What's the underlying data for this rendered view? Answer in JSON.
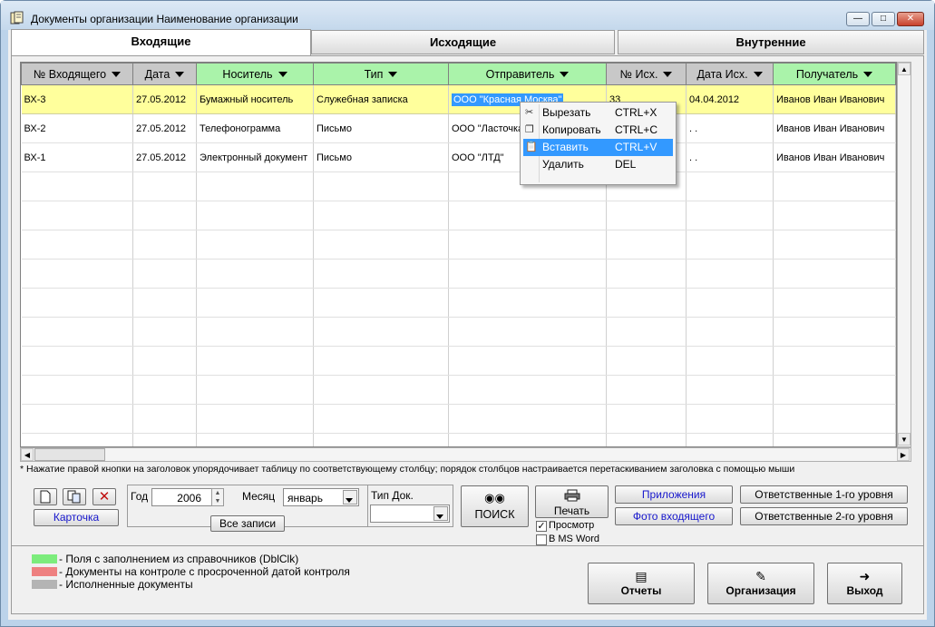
{
  "window": {
    "title": "Документы организации Наименование организации"
  },
  "tabs": [
    "Входящие",
    "Исходящие",
    "Внутренние"
  ],
  "grid": {
    "columns": [
      "№ Входящего",
      "Дата",
      "Носитель",
      "Тип",
      "Отправитель",
      "№ Исх.",
      "Дата Исх.",
      "Получатель"
    ],
    "rows": [
      [
        "ВХ-3",
        "27.05.2012",
        "Бумажный носитель",
        "Служебная записка",
        "ООО \"Красная Москва\"",
        "33",
        "04.04.2012",
        "Иванов Иван Иванович"
      ],
      [
        "ВХ-2",
        "27.05.2012",
        "Телефонограмма",
        "Письмо",
        "ООО \"Ласточка\"",
        "",
        ". .",
        "Иванов Иван Иванович"
      ],
      [
        "ВХ-1",
        "27.05.2012",
        "Электронный документ",
        "Письмо",
        "ООО \"ЛТД\"",
        "",
        ". .",
        "Иванов Иван Иванович"
      ]
    ]
  },
  "context_menu": [
    {
      "label": "Вырезать",
      "key": "CTRL+X",
      "icon": "scissors-icon"
    },
    {
      "label": "Копировать",
      "key": "CTRL+C",
      "icon": "copy-icon"
    },
    {
      "label": "Вставить",
      "key": "CTRL+V",
      "icon": "paste-icon"
    },
    {
      "label": "Удалить",
      "key": "DEL",
      "icon": ""
    }
  ],
  "hint": "* Нажатие правой кнопки на заголовок упорядочивает таблицу по соответствующему  столбцу;  порядок столбцов настраивается перетаскиванием заголовка с помощью мыши",
  "controls": {
    "card_button": "Карточка",
    "year_label": "Год",
    "year_value": "2006",
    "month_label": "Месяц",
    "month_value": "январь",
    "all_records": "Все записи",
    "doc_type_label": "Тип Док.",
    "doc_type_value": "",
    "search_button": "ПОИСК",
    "print_button": "Печать",
    "preview_label": "Просмотр",
    "preview_checked": true,
    "msword_label": "В MS Word",
    "msword_checked": false,
    "attachments_button": "Приложения",
    "photo_button": "Фото входящего",
    "resp1_button": "Ответственные 1-го уровня",
    "resp2_button": "Ответственные 2-го уровня"
  },
  "legend": [
    {
      "text": "- Поля с заполнением из справочников (DblClk)",
      "color": "#7cec7c"
    },
    {
      "text": "- Документы на контроле с просроченной датой контроля",
      "color": "#ee8080"
    },
    {
      "text": "- Исполненные документы",
      "color": "#b4b4b4"
    }
  ],
  "footer_buttons": [
    "Отчеты",
    "Организация",
    "Выход"
  ]
}
